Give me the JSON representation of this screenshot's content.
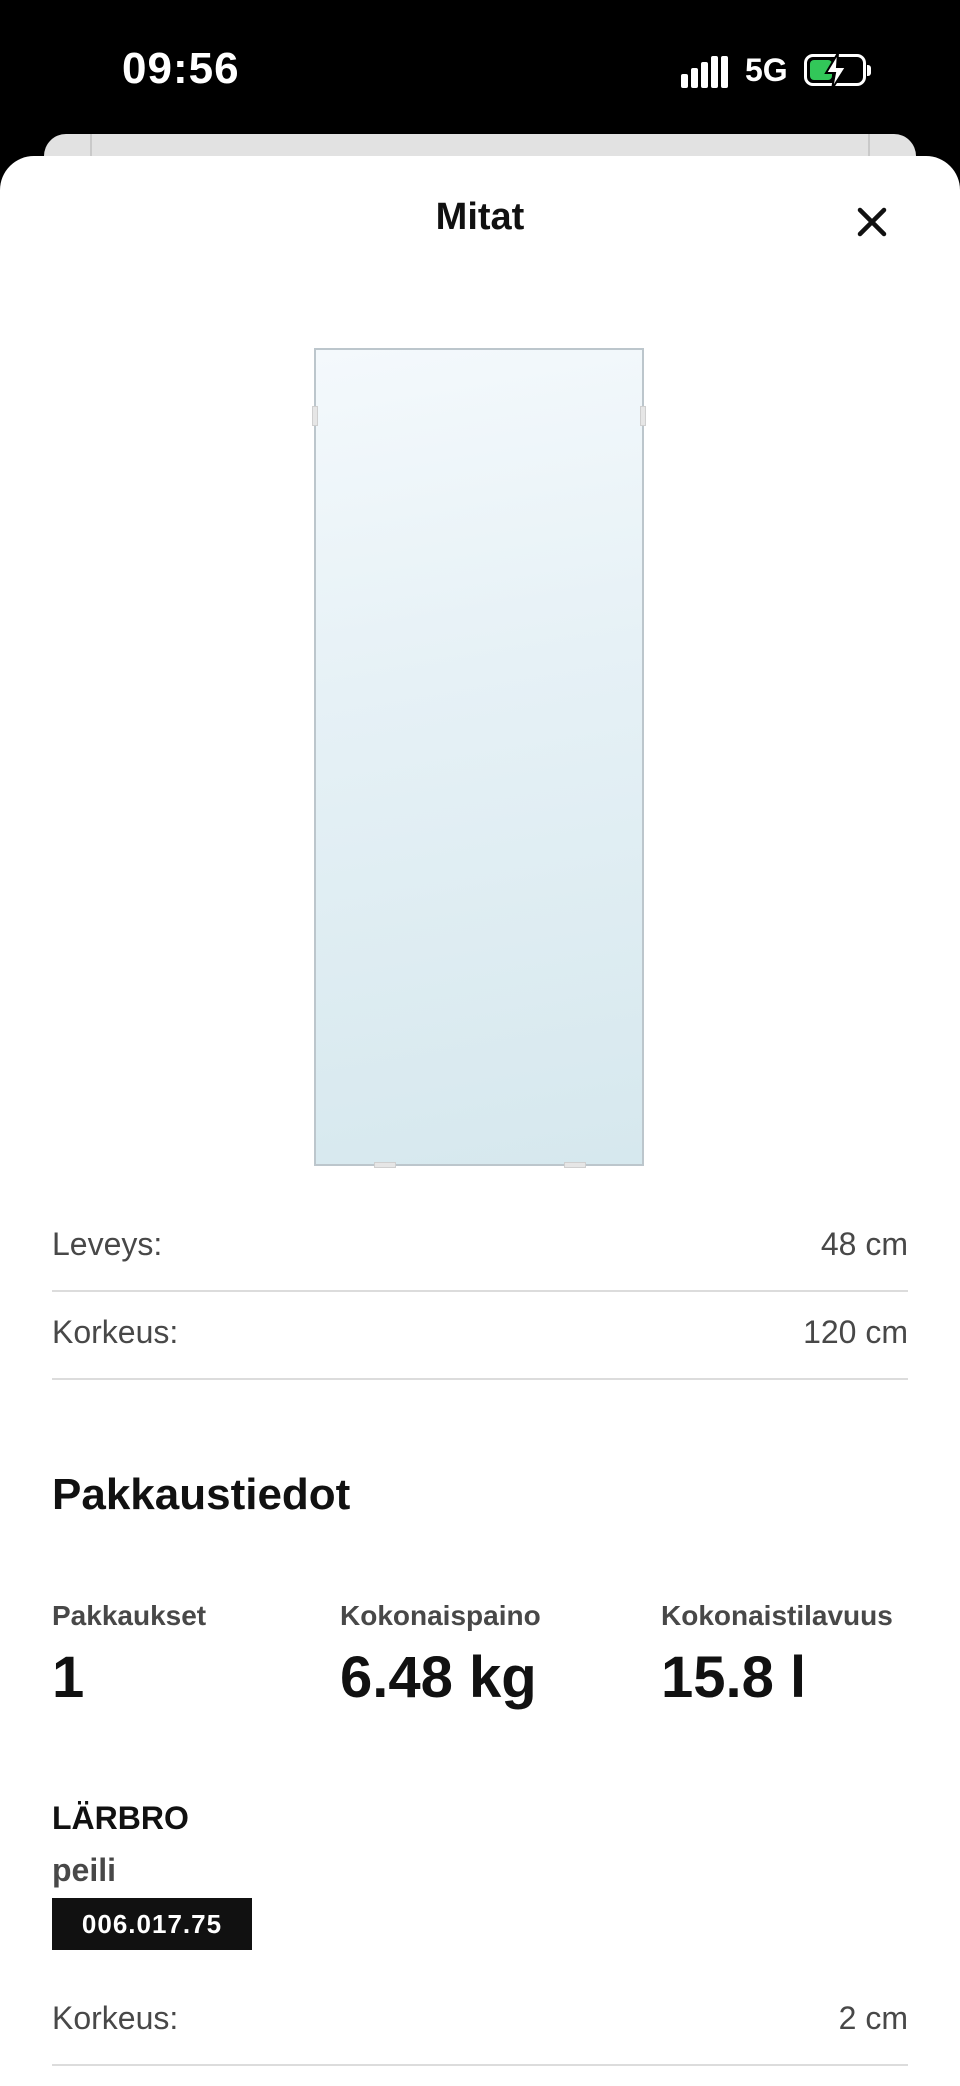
{
  "status_bar": {
    "time": "09:56",
    "network": "5G",
    "battery_fill_fraction": 0.4,
    "battery_charging": true
  },
  "sheet": {
    "title": "Mitat",
    "close_icon": "close-icon",
    "product_image": "mirror-image",
    "dimensions": [
      {
        "label": "Leveys:",
        "value": "48 cm"
      },
      {
        "label": "Korkeus:",
        "value": "120 cm"
      }
    ],
    "packaging": {
      "title": "Pakkaustiedot",
      "stats": [
        {
          "label": "Pakkaukset",
          "value": "1"
        },
        {
          "label": "Kokonaispaino",
          "value": "6.48 kg"
        },
        {
          "label": "Kokonaistilavuus",
          "value": "15.8 l"
        }
      ],
      "product_name": "LÄRBRO",
      "product_type": "peili",
      "article_number": "006.017.75",
      "package_dimensions": [
        {
          "label": "Korkeus:",
          "value": "2 cm"
        }
      ]
    }
  },
  "colors": {
    "status_bar_bg": "#000000",
    "battery_green": "#32c759",
    "sheet_bg": "#ffffff",
    "article_badge_bg": "#111111"
  }
}
